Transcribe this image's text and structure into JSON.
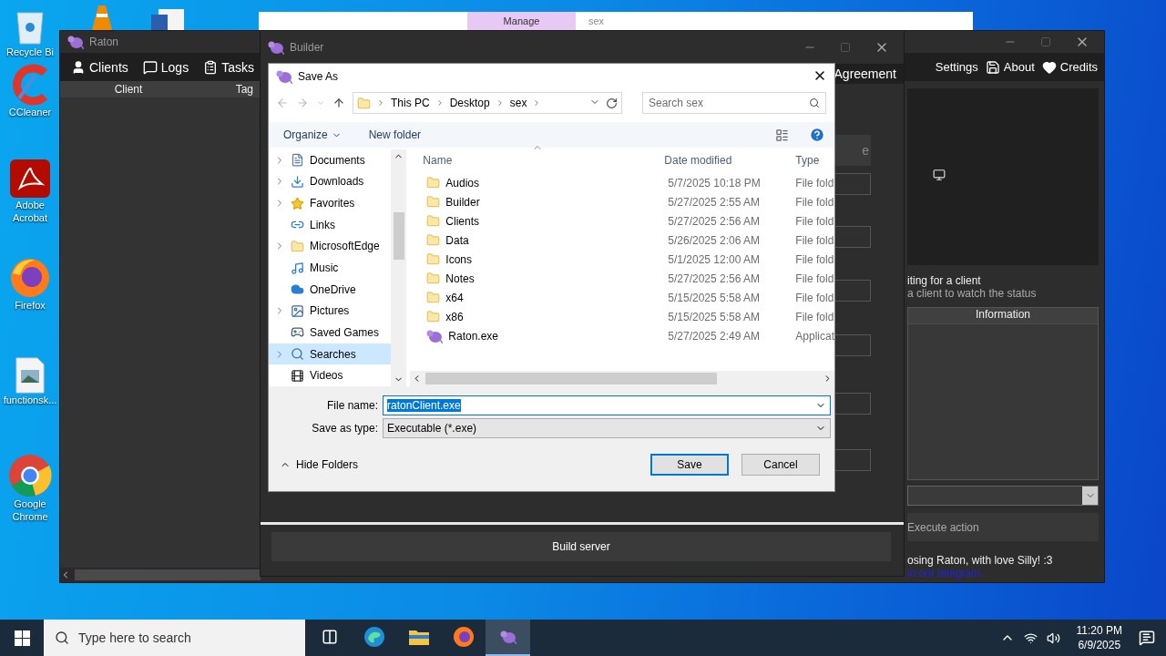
{
  "desktop_icons": [
    {
      "label": "Recycle Bi",
      "kind": "recycle"
    },
    {
      "label": "CCleaner",
      "kind": "ccleaner"
    },
    {
      "label": "Adobe Acrobat",
      "kind": "acrobat"
    },
    {
      "label": "Firefox",
      "kind": "firefox"
    },
    {
      "label": "functionsk...",
      "kind": "image"
    },
    {
      "label": "Google Chrome",
      "kind": "chrome"
    }
  ],
  "background_window": {
    "tab": "Manage",
    "title": "sex"
  },
  "raton": {
    "title": "Raton",
    "menu_left": [
      {
        "label": "Clients",
        "kind": "user"
      },
      {
        "label": "Logs",
        "kind": "logs"
      },
      {
        "label": "Tasks",
        "kind": "tasks"
      }
    ],
    "menu_right": [
      {
        "label": "Settings",
        "kind": "settings"
      },
      {
        "label": "About",
        "kind": "about"
      },
      {
        "label": "Credits",
        "kind": "credits"
      }
    ],
    "columns": [
      "Client",
      "Tag"
    ],
    "status_title": "iting for a client",
    "status_hint": "a client to watch the status",
    "info_header": "Information",
    "action_button": "Execute action",
    "footer": "osing Raton, with love Silly! :3",
    "footer_link": "in our telegram"
  },
  "builder": {
    "title": "Builder",
    "tab": "Agreement",
    "side_button": "e",
    "build_button": "Build server"
  },
  "save_as": {
    "title": "Save As",
    "breadcrumb": [
      "This PC",
      "Desktop",
      "sex"
    ],
    "search_placeholder": "Search sex",
    "organize": "Organize",
    "new_folder": "New folder",
    "tree": [
      {
        "label": "Documents",
        "kind": "documents",
        "expandable": true,
        "selected": false
      },
      {
        "label": "Downloads",
        "kind": "downloads",
        "expandable": true,
        "selected": false
      },
      {
        "label": "Favorites",
        "kind": "favorites",
        "expandable": true,
        "selected": false
      },
      {
        "label": "Links",
        "kind": "links",
        "expandable": false,
        "selected": false
      },
      {
        "label": "MicrosoftEdge",
        "kind": "folder",
        "expandable": true,
        "selected": false
      },
      {
        "label": "Music",
        "kind": "music",
        "expandable": false,
        "selected": false
      },
      {
        "label": "OneDrive",
        "kind": "onedrive",
        "expandable": false,
        "selected": false
      },
      {
        "label": "Pictures",
        "kind": "pictures",
        "expandable": true,
        "selected": false
      },
      {
        "label": "Saved Games",
        "kind": "games",
        "expandable": false,
        "selected": false
      },
      {
        "label": "Searches",
        "kind": "searches",
        "expandable": true,
        "selected": true
      },
      {
        "label": "Videos",
        "kind": "videos",
        "expandable": false,
        "selected": false
      }
    ],
    "columns": [
      "Name",
      "Date modified",
      "Type"
    ],
    "files": [
      {
        "name": "Audios",
        "date": "5/7/2025 10:18 PM",
        "type": "File fold",
        "kind": "folder"
      },
      {
        "name": "Builder",
        "date": "5/27/2025 2:55 AM",
        "type": "File fold",
        "kind": "folder"
      },
      {
        "name": "Clients",
        "date": "5/27/2025 2:56 AM",
        "type": "File fold",
        "kind": "folder"
      },
      {
        "name": "Data",
        "date": "5/26/2025 2:06 AM",
        "type": "File fold",
        "kind": "folder"
      },
      {
        "name": "Icons",
        "date": "5/1/2025 12:00 AM",
        "type": "File fold",
        "kind": "folder"
      },
      {
        "name": "Notes",
        "date": "5/27/2025 2:56 AM",
        "type": "File fold",
        "kind": "folder"
      },
      {
        "name": "x64",
        "date": "5/15/2025 5:58 AM",
        "type": "File fold",
        "kind": "folder"
      },
      {
        "name": "x86",
        "date": "5/15/2025 5:58 AM",
        "type": "File fold",
        "kind": "folder"
      },
      {
        "name": "Raton.exe",
        "date": "5/27/2025 2:49 AM",
        "type": "Applicat",
        "kind": "app"
      }
    ],
    "file_name_label": "File name:",
    "file_name": "ratonClient.exe",
    "type_label": "Save as type:",
    "type_value": "Executable (*.exe)",
    "hide_folders": "Hide Folders",
    "save": "Save",
    "cancel": "Cancel"
  },
  "taskbar": {
    "search_placeholder": "Type here to search",
    "apps": [
      {
        "kind": "taskview",
        "active": false
      },
      {
        "kind": "edge",
        "active": false
      },
      {
        "kind": "explorer",
        "active": false
      },
      {
        "kind": "firefox",
        "active": false
      },
      {
        "kind": "raton",
        "active": true
      }
    ],
    "time": "11:20 PM",
    "date": "6/9/2025"
  }
}
